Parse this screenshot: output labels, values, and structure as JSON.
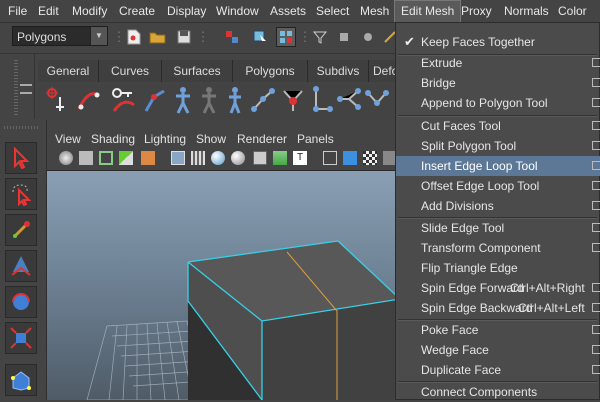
{
  "menubar": {
    "items": [
      "File",
      "Edit",
      "Modify",
      "Create",
      "Display",
      "Window",
      "Assets",
      "Select",
      "Mesh",
      "Edit Mesh",
      "Proxy",
      "Normals",
      "Color"
    ]
  },
  "statusline": {
    "mode_dropdown": "Polygons"
  },
  "shelf": {
    "tabs": [
      "General",
      "Curves",
      "Surfaces",
      "Polygons",
      "Subdivs",
      "Defo"
    ]
  },
  "panel": {
    "menu": [
      "View",
      "Shading",
      "Lighting",
      "Show",
      "Renderer",
      "Panels"
    ]
  },
  "edit_mesh_menu": {
    "keep_faces": "Keep Faces Together",
    "items": [
      {
        "label": "Extrude",
        "option_box": true
      },
      {
        "label": "Bridge",
        "option_box": true
      },
      {
        "label": "Append to Polygon Tool",
        "option_box": true
      },
      {
        "label": "Cut Faces Tool",
        "option_box": true
      },
      {
        "label": "Split Polygon Tool",
        "option_box": true
      },
      {
        "label": "Insert Edge Loop Tool",
        "option_box": true,
        "highlighted": true
      },
      {
        "label": "Offset Edge Loop Tool",
        "option_box": true
      },
      {
        "label": "Add Divisions",
        "option_box": true
      },
      {
        "label": "Slide Edge Tool",
        "option_box": true
      },
      {
        "label": "Transform Component",
        "option_box": true
      },
      {
        "label": "Flip Triangle Edge",
        "option_box": false
      },
      {
        "label": "Spin Edge Forward",
        "shortcut": "Ctrl+Alt+Right",
        "option_box": true
      },
      {
        "label": "Spin Edge Backward",
        "shortcut": "Ctrl+Alt+Left",
        "option_box": true
      },
      {
        "label": "Poke Face",
        "option_box": true
      },
      {
        "label": "Wedge Face",
        "option_box": true
      },
      {
        "label": "Duplicate Face",
        "option_box": true
      },
      {
        "label": "Connect Components",
        "option_box": false
      }
    ]
  },
  "colors": {
    "highlight": "#5c7896",
    "selection_edge": "#39d0e8",
    "edge_loop": "#e0a040",
    "viewport_top": "#8a9fb3",
    "viewport_bottom": "#4f5c68"
  }
}
